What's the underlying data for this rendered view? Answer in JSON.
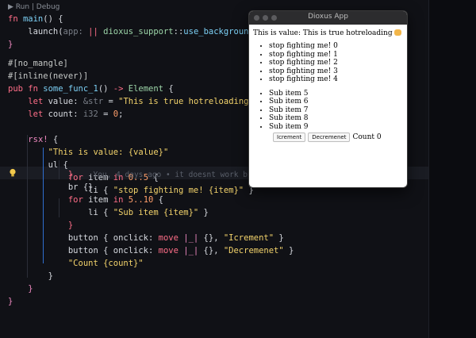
{
  "editor": {
    "codelens": "▶ Run | Debug",
    "lines": [
      {
        "text_a": "fn ",
        "text_b": "main",
        "text_c": "() {"
      },
      {
        "text_a": "    launch(",
        "text_b": "app: ",
        "text_c": "|| ",
        "text_d": "dioxus_support::use_background_hotreloa"
      },
      {
        "text": "}"
      },
      {
        "text": ""
      },
      {
        "text": "#[no_mangle]"
      },
      {
        "text": "#[inline(never)]"
      },
      {
        "text_a": "pub fn ",
        "text_b": "some_func_1",
        "text_c": "() -> ",
        "text_d": "Element",
        " text_e": " {"
      },
      {
        "text_a": "    let value: ",
        "text_b": "&str",
        " text_c": " = ",
        "text_d": "\"This is true hotreloading 😺\"",
        ";": ";"
      },
      {
        "text_a": "    let count: ",
        "text_b": "i32",
        " text_c": " = ",
        "text_d": "0",
        ";": ";"
      },
      {
        "text": ""
      },
      {
        "text_a": "    rsx! {",
        "text": ""
      },
      {
        "text": "        \"This is value: {value}\""
      },
      {
        "text": "        ul {"
      },
      {
        "text": "            for item in 0..5 {"
      },
      {
        "text": "                li { \"stop fighting me! {item}\" }"
      },
      {
        "text": "            }",
        "ghost": "You, 4 days ago • it doesnt work but i"
      },
      {
        "text": "            br {}"
      },
      {
        "text": "            for item in 5..10 {"
      },
      {
        "text": "                li { \"Sub item {item}\" }"
      },
      {
        "text": "            }"
      },
      {
        "text": "            button { onclick: move |_| {}, \"Icrement\" }"
      },
      {
        "text": "            button { onclick: move |_| {}, \"Decremenet\" }"
      },
      {
        "text": "            \"Count {count}\""
      },
      {
        "text": "        }"
      },
      {
        "text": "    }"
      },
      {
        "text": "}"
      }
    ]
  },
  "window": {
    "title": "Dioxus App",
    "value_text": "This is value: This is true hotreloading",
    "list1": [
      "stop fighting me! 0",
      "stop fighting me! 1",
      "stop fighting me! 2",
      "stop fighting me! 3",
      "stop fighting me! 4"
    ],
    "list2": [
      "Sub item 5",
      "Sub item 6",
      "Sub item 7",
      "Sub item 8",
      "Sub item 9"
    ],
    "btn_inc": "Icrement",
    "btn_dec": "Decremenet",
    "count_text": "Count 0"
  }
}
